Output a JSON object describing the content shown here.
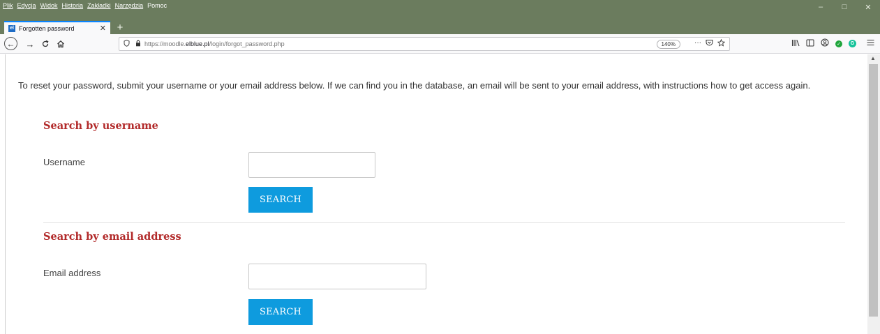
{
  "menu": {
    "items": [
      "Plik",
      "Edycja",
      "Widok",
      "Historia",
      "Zakładki",
      "Narzędzia",
      "Pomoc"
    ]
  },
  "window": {
    "minimize": "–",
    "maximize": "□",
    "close": "✕"
  },
  "tab": {
    "title": "Forgotten password",
    "favicon": "el",
    "close": "✕",
    "new": "+"
  },
  "nav": {
    "back": "←",
    "forward": "→",
    "reload": "C",
    "home": "⌂"
  },
  "url": {
    "prefix": "https://moodle.",
    "host": "elblue.pl",
    "path": "/login/forgot_password.php",
    "zoom": "140%",
    "more": "···"
  },
  "page": {
    "intro": "To reset your password, submit your username or your email address below. If we can find you in the database, an email will be sent to your email address, with instructions how to get access again.",
    "username_section": {
      "heading": "Search by username",
      "label": "Username",
      "value": "",
      "button": "SEARCH"
    },
    "email_section": {
      "heading": "Search by email address",
      "label": "Email address",
      "value": "",
      "button": "SEARCH"
    }
  },
  "colors": {
    "accent": "#0e9bde",
    "heading": "#b22a2a",
    "titlebar": "#6b7c5e"
  }
}
